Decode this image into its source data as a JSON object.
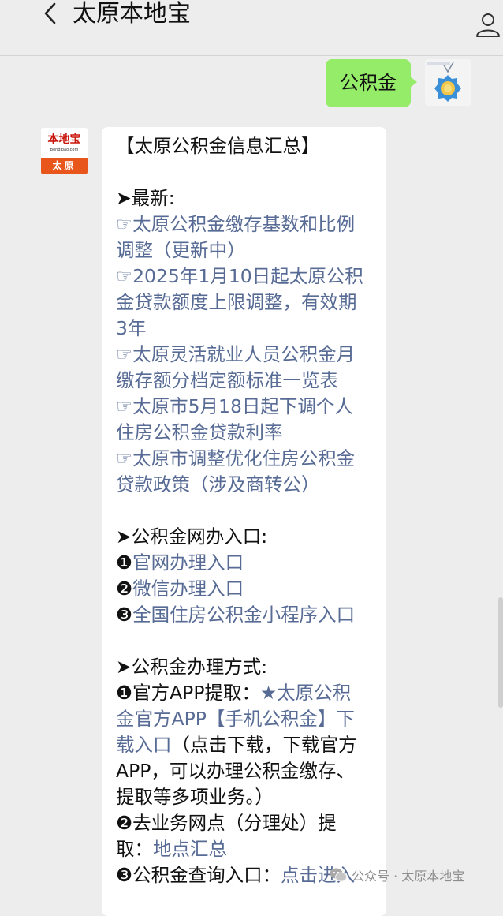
{
  "header": {
    "title": "太原本地宝",
    "back_icon": "chevron-left-icon",
    "profile_icon": "person-outline-icon"
  },
  "sent_message": {
    "text": "公积金"
  },
  "bot": {
    "avatar_brand": "本地宝",
    "avatar_domain": "Bendibao.com",
    "avatar_city": "太原"
  },
  "reply": {
    "title": "【太原公积金信息汇总】",
    "latest_heading": "➤最新:",
    "latest_items": [
      {
        "prefix": "☞",
        "lines": [
          "太原公积金缴存基数和比例",
          "调整（更新中）"
        ]
      },
      {
        "prefix": "☞",
        "lines": [
          "2025年1月10日起太原公积",
          "金贷款额度上限调整，有效期",
          "3年"
        ]
      },
      {
        "prefix": "☞",
        "lines": [
          "太原灵活就业人员公积金月",
          "缴存额分档定额标准一览表"
        ]
      },
      {
        "prefix": "☞",
        "lines": [
          "太原市5月18日起下调个人",
          "住房公积金贷款利率"
        ]
      },
      {
        "prefix": "☞",
        "lines": [
          "太原市调整优化住房公积金",
          "贷款政策（涉及商转公）"
        ]
      }
    ],
    "online_heading": "➤公积金网办入口:",
    "online_items": [
      {
        "num": "❶",
        "text": "官网办理入口"
      },
      {
        "num": "❷",
        "text": "微信办理入口"
      },
      {
        "num": "❸",
        "text": "全国住房公积金小程序入口"
      }
    ],
    "methods_heading": "➤公积金办理方式:",
    "method1_label": "❶官方APP提取：",
    "method1_link1": "★太原公积",
    "method1_link2": "金官方APP【手机公积金】下",
    "method1_link3": "载入口",
    "method1_desc1": "（点击下载，下载官方",
    "method1_desc2": "APP，可以办理公积金缴存、",
    "method1_desc3": "提取等多项业务。）",
    "method2_line1": "❷去业务网点（分理处）提",
    "method2_label": "取：",
    "method2_link": "地点汇总",
    "method3_label": "❸公积金查询入口：",
    "method3_link": "点击进入"
  },
  "watermark": {
    "text": "公众号 · 太原本地宝",
    "icon": "wechat-icon"
  },
  "colors": {
    "background": "#ededed",
    "sent_bubble": "#95ec69",
    "link": "#576b95",
    "avatar_orange": "#e8561c"
  }
}
